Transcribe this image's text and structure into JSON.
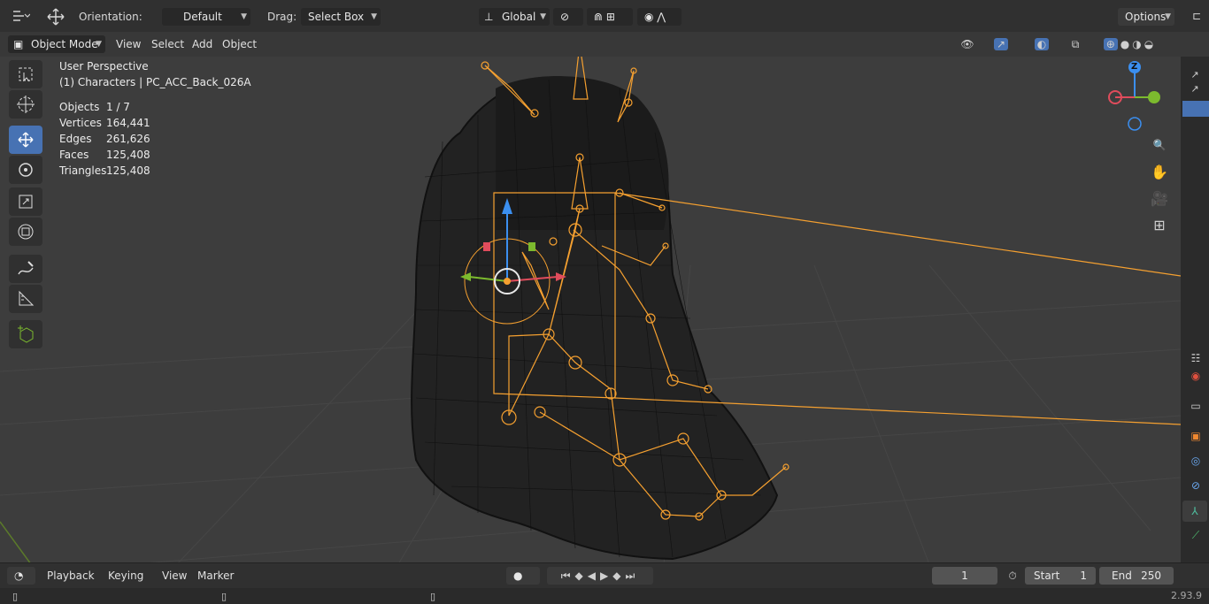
{
  "top_toolbar": {
    "orientation_label": "Orientation:",
    "orientation_value": "Default",
    "drag_label": "Drag:",
    "drag_value": "Select Box",
    "transform_space": "Global",
    "options_label": "Options"
  },
  "viewport_header": {
    "mode": "Object Mode",
    "menus": [
      "View",
      "Select",
      "Add",
      "Object"
    ]
  },
  "overlay": {
    "view_name": "User Perspective",
    "collection": "(1) Characters | PC_ACC_Back_026A",
    "stats": [
      {
        "label": "Objects",
        "value": "1 / 7"
      },
      {
        "label": "Vertices",
        "value": "164,441"
      },
      {
        "label": "Edges",
        "value": "261,626"
      },
      {
        "label": "Faces",
        "value": "125,408"
      },
      {
        "label": "Triangles",
        "value": "125,408"
      }
    ]
  },
  "gizmo": {
    "z_label": "Z",
    "x_color": "#e04c5c",
    "y_color": "#7cba2e",
    "z_color": "#3b8ff0"
  },
  "timeline": {
    "menus": [
      "Playback",
      "Keying",
      "View",
      "Marker"
    ],
    "current_frame": "1",
    "start_label": "Start",
    "start_value": "1",
    "end_label": "End",
    "end_value": "250"
  },
  "status": {
    "version": "2.93.9"
  },
  "colors": {
    "accent": "#4772b3",
    "armature": "#f5a030",
    "bg": "#3d3d3d"
  }
}
